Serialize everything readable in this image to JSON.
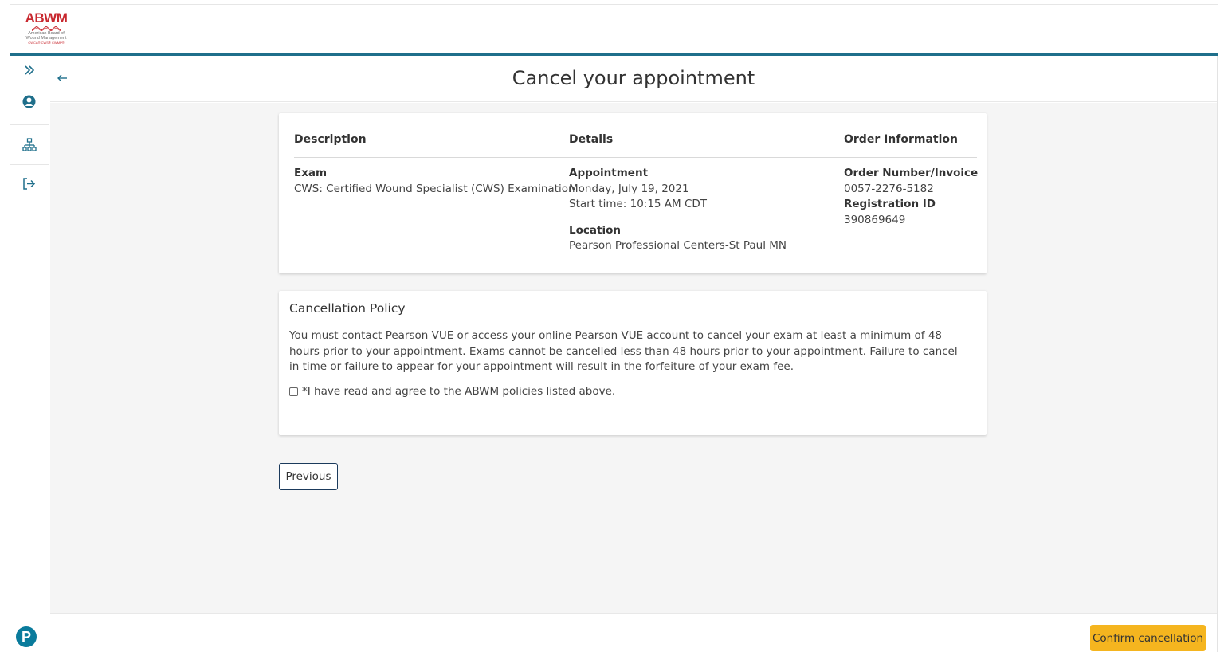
{
  "brand": {
    "logo_text": "ABWM",
    "logo_subtitle_line1": "American Board of",
    "logo_subtitle_line2": "Wound Management",
    "logo_tagline": "CWCA® CWS® CWMP®",
    "primary_color": "#1f6f8b",
    "logo_color": "#c8282f",
    "pearson_logo": "P"
  },
  "sidebar": {
    "items": [
      {
        "icon": "double-chevron-right-icon"
      },
      {
        "icon": "user-circle-icon"
      },
      {
        "icon": "sitemap-icon"
      },
      {
        "icon": "sign-out-icon"
      }
    ]
  },
  "page": {
    "title": "Cancel your appointment"
  },
  "summary": {
    "headers": {
      "description": "Description",
      "details": "Details",
      "order": "Order Information"
    },
    "exam_label": "Exam",
    "exam_value": "CWS: Certified Wound Specialist (CWS) Examination",
    "appointment_label": "Appointment",
    "appointment_date": "Monday, July 19, 2021",
    "appointment_time": "Start time: 10:15 AM CDT",
    "location_label": "Location",
    "location_value": "Pearson Professional Centers-St Paul MN",
    "order_label": "Order Number/Invoice",
    "order_value": "0057-2276-5182",
    "registration_label": "Registration ID",
    "registration_value": "390869649"
  },
  "policy": {
    "title": "Cancellation Policy",
    "text": "You must contact Pearson VUE or access your online Pearson VUE account to cancel your exam at least a minimum of 48 hours prior to your appointment. Exams cannot be cancelled less than 48 hours prior to your appointment. Failure to cancel in time or failure to appear for your appointment will result in the forfeiture of your exam fee.",
    "agree_label": "*I have read and agree to the ABWM policies listed above.",
    "agree_checked": false
  },
  "buttons": {
    "previous": "Previous",
    "confirm": "Confirm cancellation",
    "confirm_color": "#f5b51f"
  }
}
